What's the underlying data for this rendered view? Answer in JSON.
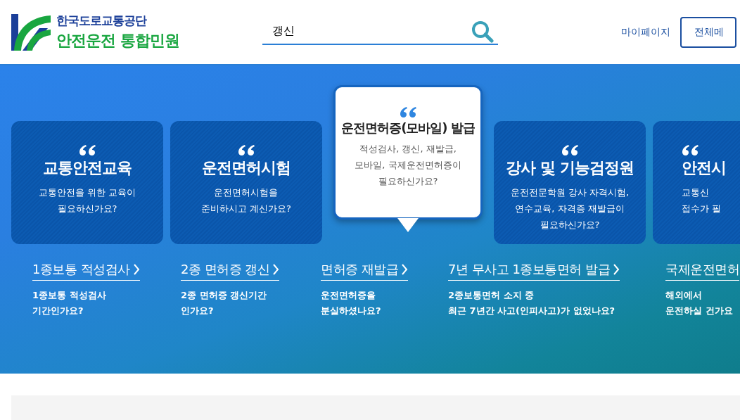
{
  "header": {
    "org": "한국도로교통공단",
    "service": "안전운전 통합민원",
    "search": {
      "value": "갱신"
    },
    "mypage": "마이페이지",
    "menu_button": "전체메"
  },
  "cards": [
    {
      "title": "교통안전교육",
      "lines": [
        "교통안전을 위한 교육이",
        "필요하신가요?"
      ],
      "selected": false
    },
    {
      "title": "운전면허시험",
      "lines": [
        "운전면허시험을",
        "준비하시고 계신가요?"
      ],
      "selected": false
    },
    {
      "title": "운전면허증(모바일) 발급",
      "lines": [
        "적성검사, 갱신, 재발급,",
        "모바일, 국제운전면허증이",
        "필요하신가요?"
      ],
      "selected": true
    },
    {
      "title": "강사 및 기능검정원",
      "lines": [
        "운전전문학원 강사 자격시험,",
        "연수교육, 자격증 재발급이",
        "필요하신가요?"
      ],
      "selected": false
    },
    {
      "title": "안전시",
      "lines": [
        "교통신",
        "접수가 필"
      ],
      "selected": false
    }
  ],
  "links": [
    {
      "title": "1종보통 적성검사",
      "lines": [
        "1종보통 적성검사",
        "기간인가요?"
      ]
    },
    {
      "title": "2종 면허증 갱신",
      "lines": [
        "2종 면허증 갱신기간",
        "인가요?"
      ]
    },
    {
      "title": "면허증 재발급",
      "lines": [
        "운전면허증을",
        "분실하셨나요?"
      ]
    },
    {
      "title": "7년 무사고 1종보통면허 발급",
      "lines": [
        "2종보통면허 소지 중",
        "최근 7년간 사고(인피사고)가 없었나요?"
      ]
    },
    {
      "title": "국제운전면허",
      "lines": [
        "해외에서",
        "운전하실 건가요"
      ]
    }
  ]
}
